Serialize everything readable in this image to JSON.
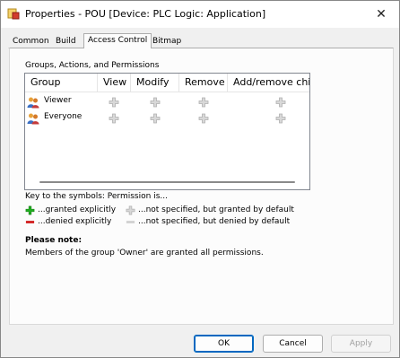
{
  "window": {
    "title": "Properties - POU [Device: PLC Logic: Application]",
    "close_glyph": "✕"
  },
  "tabs": [
    {
      "label": "Common"
    },
    {
      "label": "Build"
    },
    {
      "label": "Access Control",
      "active": true
    },
    {
      "label": "Bitmap"
    }
  ],
  "panel": {
    "group_label": "Groups, Actions, and Permissions",
    "columns": [
      "Group",
      "View",
      "Modify",
      "Remove",
      "Add/remove chil"
    ],
    "rows": [
      {
        "name": "Viewer",
        "icon": "group-icon",
        "permissions": [
          "not-specified-granted",
          "not-specified-granted",
          "not-specified-granted",
          "not-specified-granted"
        ]
      },
      {
        "name": "Everyone",
        "icon": "group-icon",
        "permissions": [
          "not-specified-granted",
          "not-specified-granted",
          "not-specified-granted",
          "not-specified-granted"
        ]
      }
    ],
    "key": {
      "title": "Key to the symbols: Permission is...",
      "granted_explicitly": "...granted explicitly",
      "denied_explicitly": "...denied explicitly",
      "not_specified_granted": "...not specified, but granted by default",
      "not_specified_denied": "...not specified, but denied by default"
    },
    "note": {
      "title": "Please note:",
      "text": "Members of the group 'Owner' are granted all permissions."
    }
  },
  "buttons": {
    "ok": "OK",
    "cancel": "Cancel",
    "apply": "Apply"
  },
  "colors": {
    "granted": "#1fae1f",
    "denied": "#d11a1a",
    "default_grey": "#c4c4c4",
    "accent": "#0067c0"
  }
}
